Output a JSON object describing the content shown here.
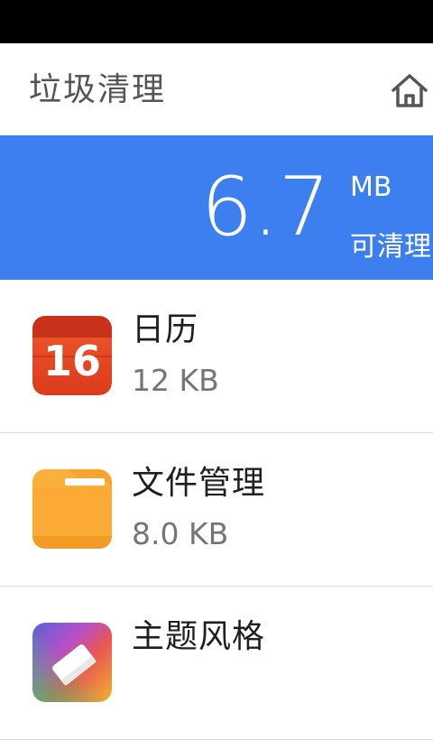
{
  "header": {
    "title": "垃圾清理",
    "home_icon": "home-icon"
  },
  "summary": {
    "size_value": "6.7",
    "size_unit": "MB",
    "caption": "可清理",
    "background_color": "#3e7ff0"
  },
  "apps": [
    {
      "name": "日历",
      "size": "12 KB",
      "icon": "calendar-icon",
      "icon_text": "16"
    },
    {
      "name": "文件管理",
      "size": "8.0 KB",
      "icon": "folder-icon"
    },
    {
      "name": "主题风格",
      "size": "",
      "icon": "theme-icon"
    }
  ]
}
